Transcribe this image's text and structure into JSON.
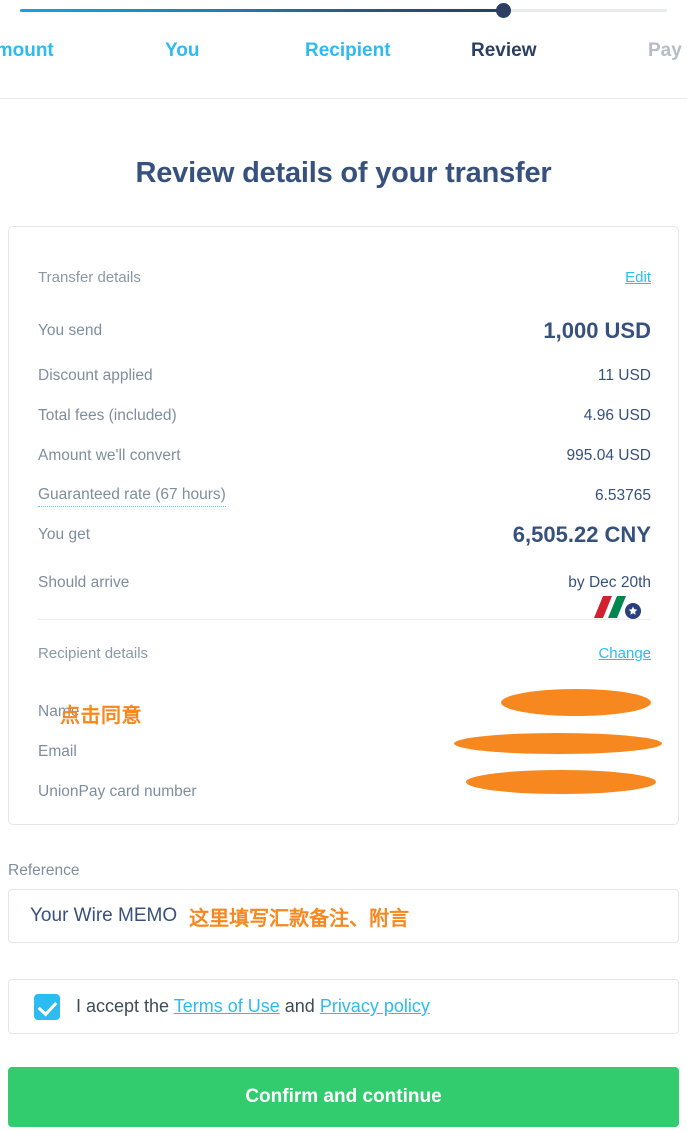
{
  "stepper": {
    "steps": [
      {
        "label": "Amount",
        "state": "done"
      },
      {
        "label": "You",
        "state": "done"
      },
      {
        "label": "Recipient",
        "state": "done"
      },
      {
        "label": "Review",
        "state": "active"
      },
      {
        "label": "Pay",
        "state": "todo"
      }
    ],
    "progress_percent": 75,
    "colors": {
      "done": "#2cbbf2",
      "active": "#2b3f63",
      "todo": "#b6bcc4",
      "track": "#e7eaec"
    }
  },
  "page_title": "Review details of your transfer",
  "transfer_section": {
    "title": "Transfer details",
    "edit_label": "Edit",
    "rows": [
      {
        "label": "You send",
        "value": "1,000 USD",
        "emphasis": true
      },
      {
        "label": "Discount applied",
        "value": "11 USD",
        "emphasis": false
      },
      {
        "label": "Total fees (included)",
        "value": "4.96 USD",
        "emphasis": false
      },
      {
        "label": "Amount we'll convert",
        "value": "995.04 USD",
        "emphasis": false
      },
      {
        "label": "Guaranteed rate (67 hours)",
        "value": "6.53765",
        "emphasis": false
      },
      {
        "label": "You get",
        "value": "6,505.22 CNY",
        "emphasis": true
      },
      {
        "label": "Should arrive",
        "value": "by Dec 20th",
        "emphasis": false
      }
    ]
  },
  "recipient_section": {
    "title": "Recipient details",
    "change_label": "Change",
    "rows": [
      {
        "label": "Name",
        "value": ""
      },
      {
        "label": "Email",
        "value": ""
      },
      {
        "label": "UnionPay card number",
        "value": ""
      }
    ],
    "logo": "unionpay-logo"
  },
  "annotations": {
    "click_agree": "点击同意",
    "reference_hint": "这里填写汇款备注、附言",
    "color": "#f7871f"
  },
  "reference": {
    "label": "Reference",
    "value": "Your Wire MEMO"
  },
  "terms": {
    "checked": true,
    "prefix": "I accept the ",
    "terms_link": "Terms of Use",
    "middle": " and ",
    "privacy_link": "Privacy policy"
  },
  "cta": {
    "label": "Confirm and continue",
    "color": "#32cb6e"
  }
}
